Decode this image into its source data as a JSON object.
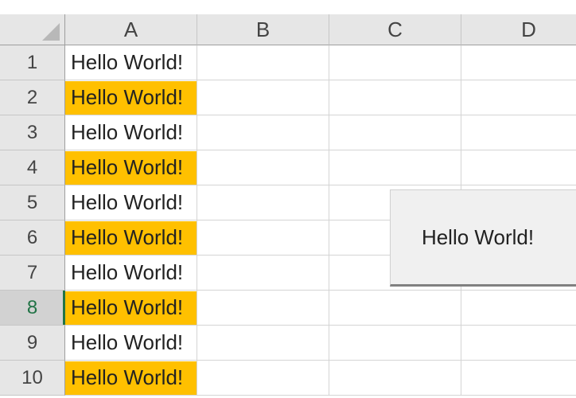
{
  "columns": [
    "A",
    "B",
    "C",
    "D"
  ],
  "rows": [
    {
      "num": "1",
      "a": "Hello World!",
      "highlight": false,
      "selected": false
    },
    {
      "num": "2",
      "a": "Hello World!",
      "highlight": true,
      "selected": false
    },
    {
      "num": "3",
      "a": "Hello World!",
      "highlight": false,
      "selected": false
    },
    {
      "num": "4",
      "a": "Hello World!",
      "highlight": true,
      "selected": false
    },
    {
      "num": "5",
      "a": "Hello World!",
      "highlight": false,
      "selected": false
    },
    {
      "num": "6",
      "a": "Hello World!",
      "highlight": true,
      "selected": false
    },
    {
      "num": "7",
      "a": "Hello World!",
      "highlight": false,
      "selected": false
    },
    {
      "num": "8",
      "a": "Hello World!",
      "highlight": true,
      "selected": true
    },
    {
      "num": "9",
      "a": "Hello World!",
      "highlight": false,
      "selected": false
    },
    {
      "num": "10",
      "a": "Hello World!",
      "highlight": true,
      "selected": false
    }
  ],
  "button": {
    "label": "Hello World!"
  },
  "colors": {
    "highlight": "#ffc000",
    "header_bg": "#e6e6e6",
    "active_row_accent": "#217346",
    "gridline": "#d4d4d4"
  }
}
